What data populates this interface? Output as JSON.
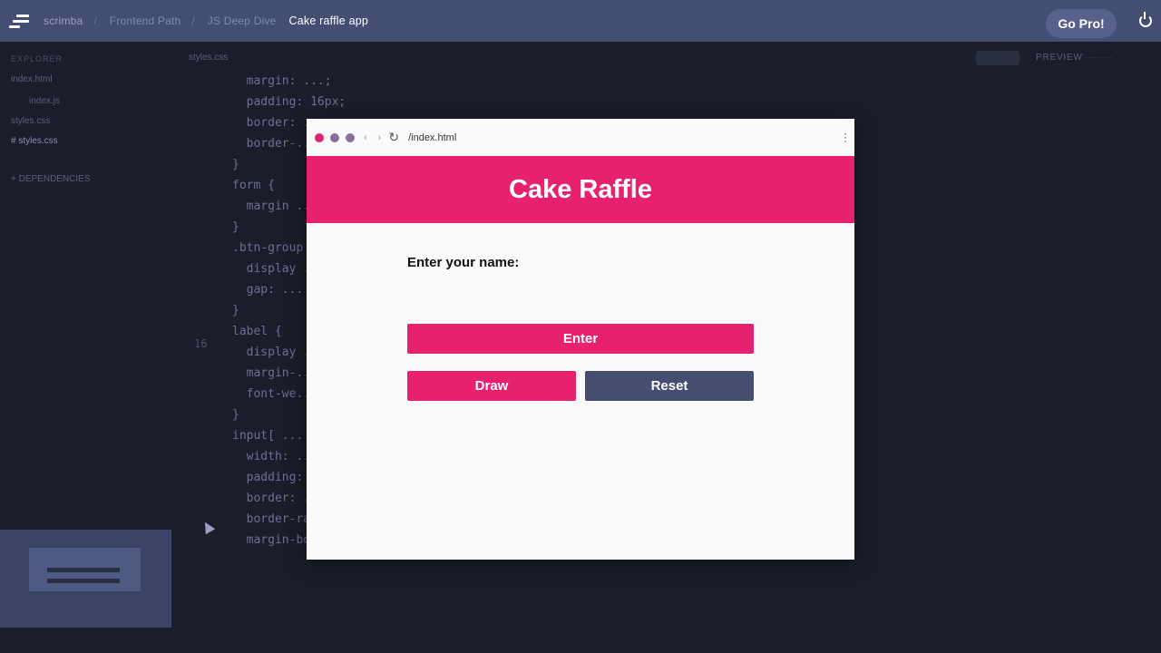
{
  "topbar": {
    "brand": "scrimba",
    "crumbs": [
      "Frontend Path",
      "JS Deep Dive",
      "Cake raffle app"
    ],
    "go_pro": "Go Pro!",
    "power_icon": "power-icon"
  },
  "sidebar": {
    "header": "EXPLORER",
    "items": [
      "index.html",
      "index.js",
      "styles.css",
      "# styles.css"
    ],
    "footer": "+ DEPENDENCIES"
  },
  "editor": {
    "tab": "styles.css",
    "preview_tab": "PREVIEW",
    "code_lines": [
      "  margin: ...;",
      "  padding: 16px;",
      "  border: ...;",
      "  border-...",
      "}",
      "",
      "form {",
      "  margin ...",
      "}",
      "",
      ".btn-group {",
      "  display ...",
      "  gap: ...",
      "}",
      "",
      "label {",
      "  display ...",
      "  margin-...",
      "  font-we...",
      "}",
      "",
      "input[ ...",
      "  width: ...",
      "  padding: ...;",
      "  border: ...;",
      "  border-radius: ...;",
      "  margin-bottom: ...;"
    ],
    "line_number": "16"
  },
  "browser": {
    "url": "/index.html"
  },
  "app": {
    "title": "Cake Raffle",
    "label": "Enter your name:",
    "enter_button": "Enter",
    "draw_button": "Draw",
    "reset_button": "Reset"
  },
  "colors": {
    "accent": "#e8216f",
    "secondary": "#454e70",
    "topbar": "#444d72"
  }
}
